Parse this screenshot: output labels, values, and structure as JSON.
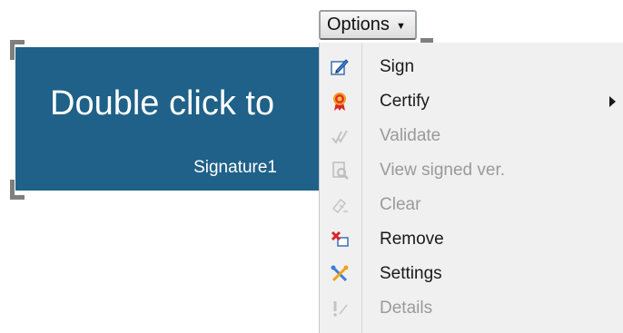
{
  "signature_field": {
    "main_text": "Double click to",
    "name": "Signature1"
  },
  "options_button": {
    "label": "Options"
  },
  "menu": {
    "items": [
      {
        "label": "Sign",
        "icon": "pen-sign-icon",
        "enabled": true
      },
      {
        "label": "Certify",
        "icon": "ribbon-certify-icon",
        "enabled": true,
        "has_submenu": true
      },
      {
        "label": "Validate",
        "icon": "validate-checkmarks-icon",
        "enabled": false
      },
      {
        "label": "View signed ver.",
        "icon": "view-document-icon",
        "enabled": false
      },
      {
        "label": "Clear",
        "icon": "eraser-icon",
        "enabled": false
      },
      {
        "label": "Remove",
        "icon": "remove-x-icon",
        "enabled": true
      },
      {
        "label": "Settings",
        "icon": "settings-tools-icon",
        "enabled": true
      },
      {
        "label": "Details",
        "icon": "details-info-icon",
        "enabled": false
      }
    ]
  },
  "colors": {
    "field_background": "#1f6188",
    "menu_background": "#f0f0f0",
    "disabled_text": "#9a9a9a"
  }
}
